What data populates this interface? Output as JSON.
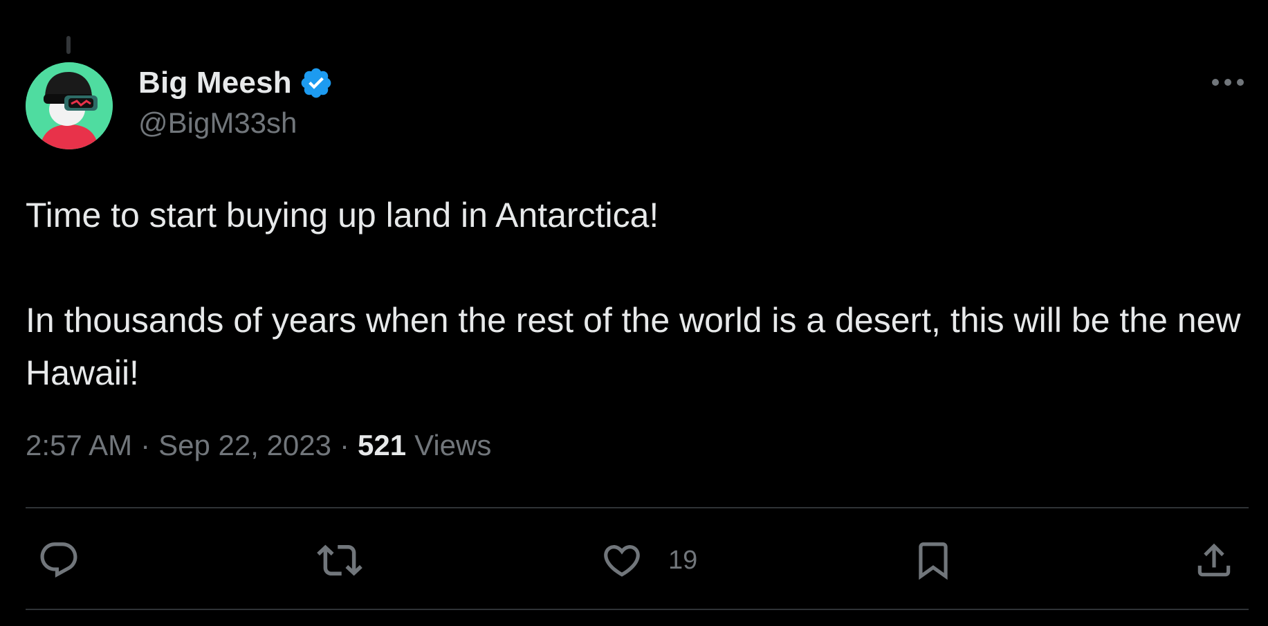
{
  "author": {
    "display_name": "Big Meesh",
    "handle": "@BigM33sh",
    "verified": true,
    "avatar_icon": "avatar-cartoon-vr-headset"
  },
  "tweet": {
    "text": "Time to start buying up land in Antarctica!\n\nIn thousands of years when the rest of the world is a desert, this will be the new Hawaii!"
  },
  "meta": {
    "time": "2:57 AM",
    "separator": "·",
    "date": "Sep 22, 2023",
    "views_count": "521",
    "views_label": "Views"
  },
  "actions": {
    "reply_icon": "reply-icon",
    "retweet_icon": "retweet-icon",
    "like_icon": "heart-icon",
    "like_count": "19",
    "bookmark_icon": "bookmark-icon",
    "share_icon": "share-icon",
    "more_icon": "more-icon"
  },
  "colors": {
    "background": "#000000",
    "primary_text": "#e7e9ea",
    "secondary_text": "#71767b",
    "verified_blue": "#1d9bf0",
    "divider": "#2f3336"
  }
}
